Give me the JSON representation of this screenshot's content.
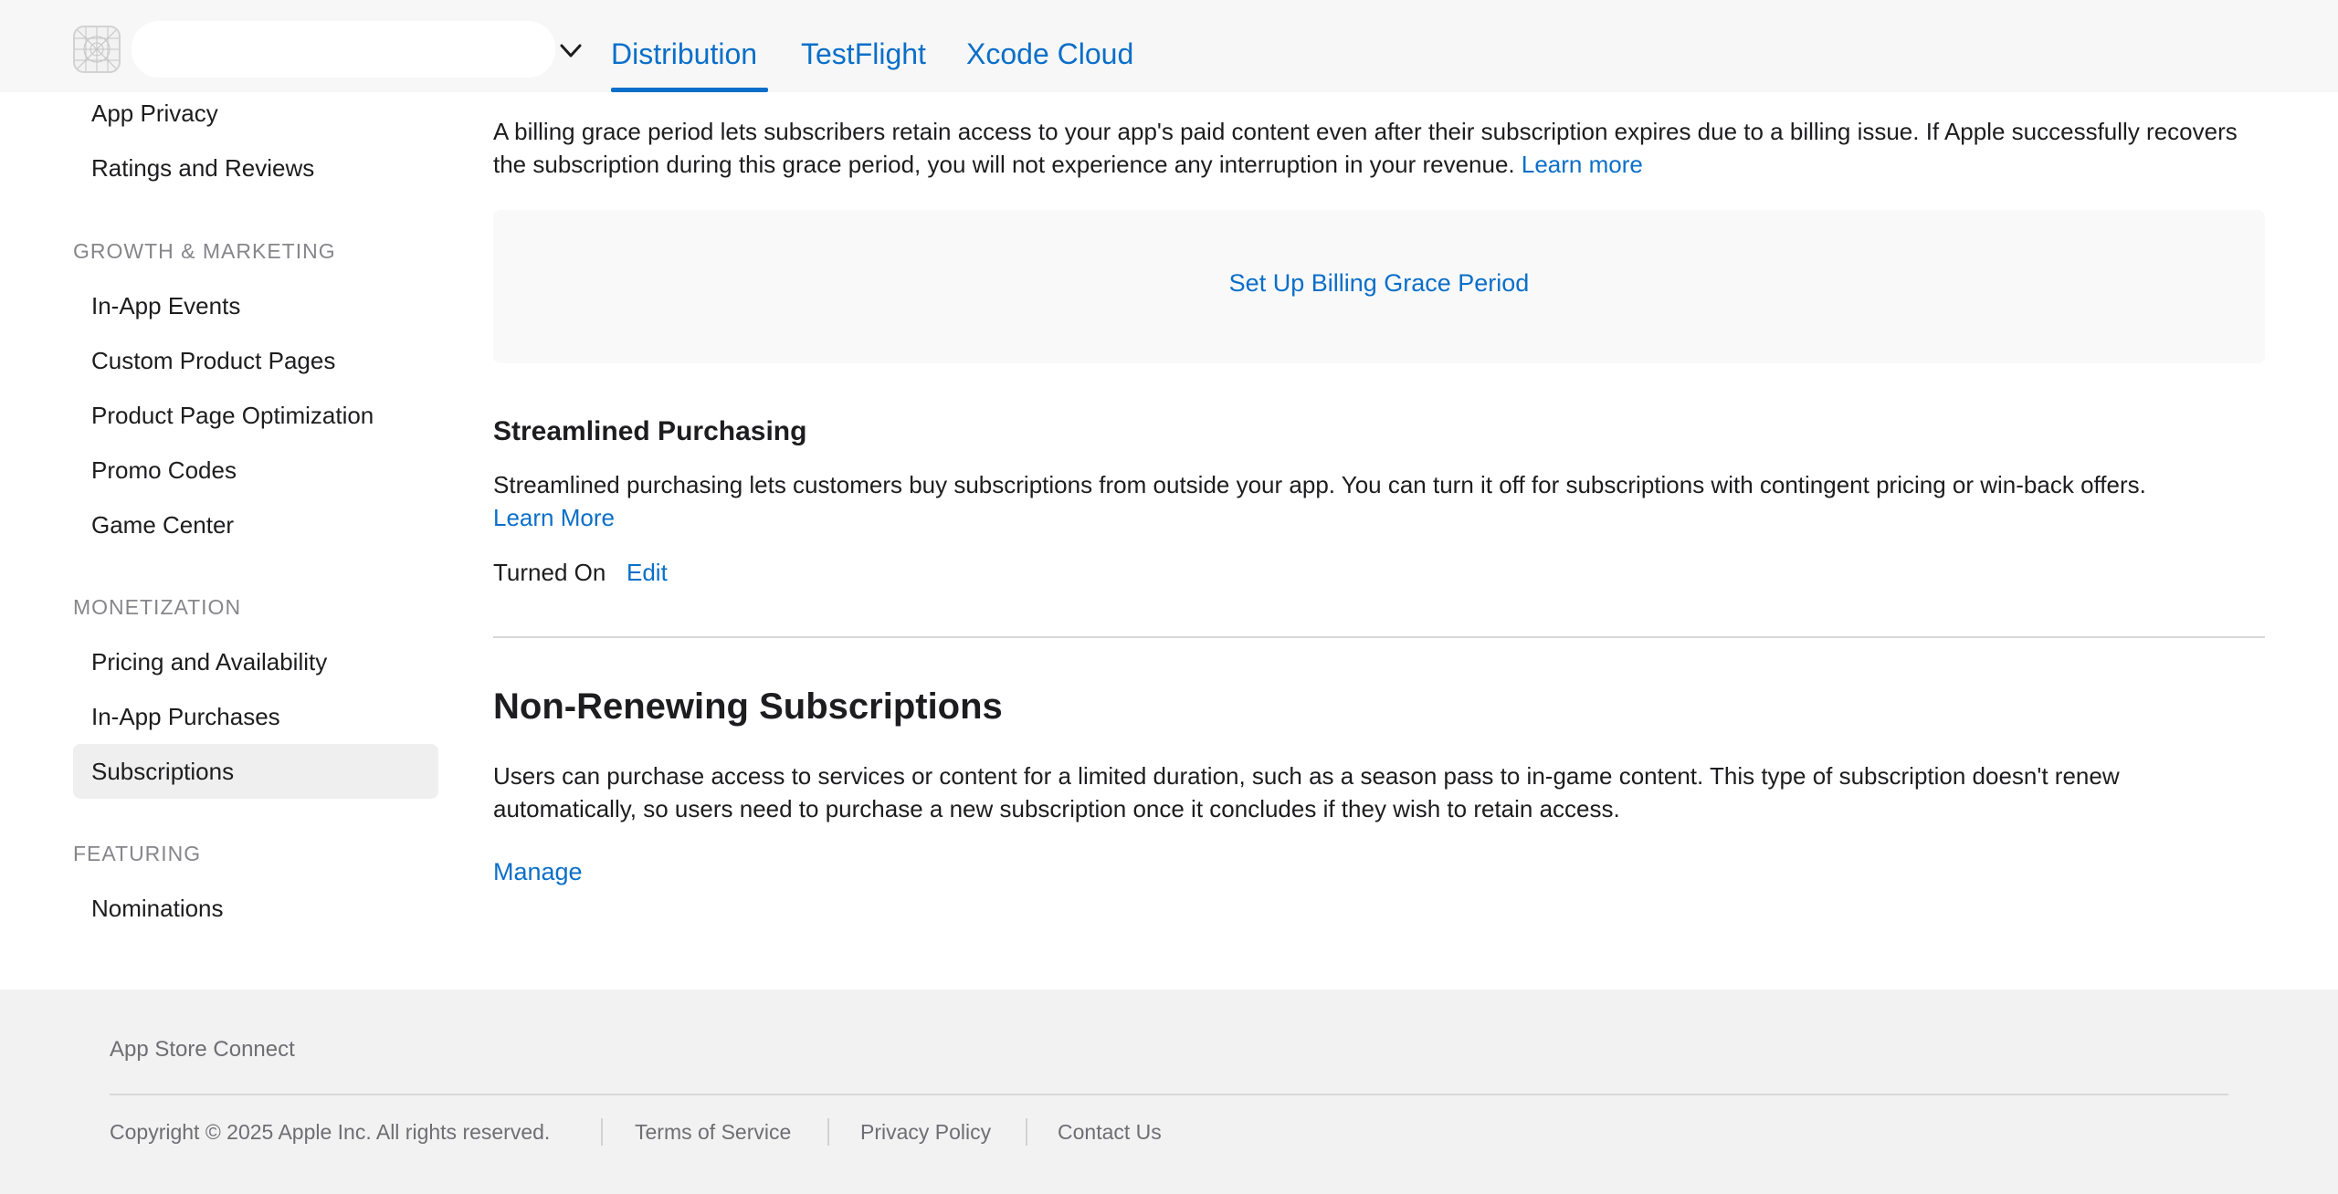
{
  "nav": {
    "app_name": "",
    "tabs": [
      {
        "label": "Distribution",
        "active": true
      },
      {
        "label": "TestFlight",
        "active": false
      },
      {
        "label": "Xcode Cloud",
        "active": false
      }
    ]
  },
  "sidebar": {
    "items_top": [
      {
        "label": "App Privacy"
      },
      {
        "label": "Ratings and Reviews"
      }
    ],
    "sections": [
      {
        "heading": "GROWTH & MARKETING",
        "items": [
          {
            "label": "In-App Events"
          },
          {
            "label": "Custom Product Pages"
          },
          {
            "label": "Product Page Optimization"
          },
          {
            "label": "Promo Codes"
          },
          {
            "label": "Game Center"
          }
        ]
      },
      {
        "heading": "MONETIZATION",
        "items": [
          {
            "label": "Pricing and Availability"
          },
          {
            "label": "In-App Purchases"
          },
          {
            "label": "Subscriptions",
            "selected": true
          }
        ]
      },
      {
        "heading": "FEATURING",
        "items": [
          {
            "label": "Nominations"
          }
        ]
      }
    ]
  },
  "main": {
    "billing_grace": {
      "description": "A billing grace period lets subscribers retain access to your app's paid content even after their subscription expires due to a billing issue. If Apple successfully recovers the subscription during this grace period, you will not experience any interruption in your revenue.",
      "learn_more": "Learn more",
      "setup_button": "Set Up Billing Grace Period"
    },
    "streamlined": {
      "title": "Streamlined Purchasing",
      "description": "Streamlined purchasing lets customers buy subscriptions from outside your app. You can turn it off for subscriptions with contingent pricing or win-back offers.",
      "learn_more": "Learn More",
      "status": "Turned On",
      "edit": "Edit"
    },
    "non_renewing": {
      "title": "Non-Renewing Subscriptions",
      "description": "Users can purchase access to services or content for a limited duration, such as a season pass to in-game content. This type of subscription doesn't renew automatically, so users need to purchase a new subscription once it concludes if they wish to retain access.",
      "manage": "Manage"
    }
  },
  "footer": {
    "brand": "App Store Connect",
    "copyright": "Copyright © 2025 Apple Inc. All rights reserved.",
    "links": [
      "Terms of Service",
      "Privacy Policy",
      "Contact Us"
    ]
  },
  "colors": {
    "accent": "#0a6fc9",
    "text": "#1d1d1f",
    "muted": "#86868b",
    "selected_bg": "#efefef",
    "footer_bg": "#f2f2f2"
  }
}
